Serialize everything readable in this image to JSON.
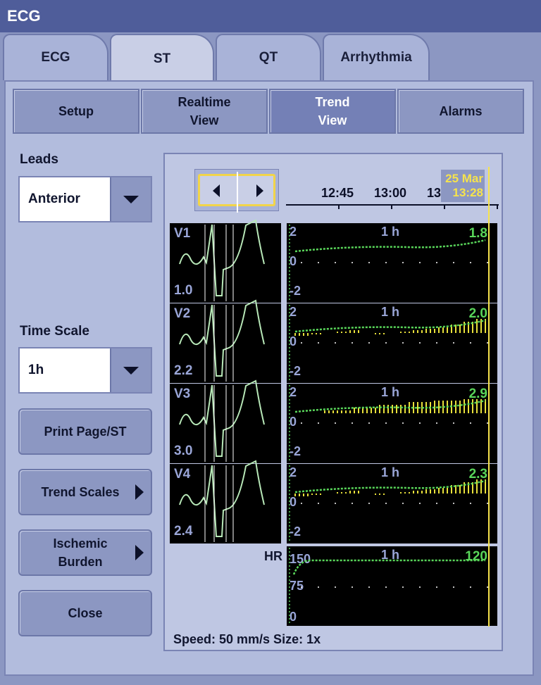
{
  "window": {
    "title": "ECG"
  },
  "tabs": [
    {
      "label": "ECG",
      "active": false
    },
    {
      "label": "ST",
      "active": true
    },
    {
      "label": "QT",
      "active": false
    },
    {
      "label": "Arrhythmia",
      "active": false
    }
  ],
  "subtabs": {
    "setup": "Setup",
    "realtime": [
      "Realtime",
      "View"
    ],
    "trend": [
      "Trend",
      "View"
    ],
    "alarms": "Alarms"
  },
  "left": {
    "leads_label": "Leads",
    "leads_value": "Anterior",
    "timescale_label": "Time Scale",
    "timescale_value": "1h",
    "print_button": "Print Page/ST",
    "trend_scales_button": "Trend Scales",
    "ischemic_button": [
      "Ischemic",
      "Burden"
    ],
    "close_button": "Close"
  },
  "timeline": {
    "ticks": [
      "12:45",
      "13:00",
      "13"
    ],
    "date": "25 Mar",
    "time": "13:28"
  },
  "leads": [
    {
      "name": "V1",
      "value": "1.0",
      "y_top": "2",
      "y_mid": "0",
      "y_bot": "-2",
      "span": "1 h",
      "current": "1.8"
    },
    {
      "name": "V2",
      "value": "2.2",
      "y_top": "2",
      "y_mid": "0",
      "y_bot": "-2",
      "span": "1 h",
      "current": "2.0"
    },
    {
      "name": "V3",
      "value": "3.0",
      "y_top": "2",
      "y_mid": "0",
      "y_bot": "-2",
      "span": "1 h",
      "current": "2.9"
    },
    {
      "name": "V4",
      "value": "2.4",
      "y_top": "2",
      "y_mid": "0",
      "y_bot": "-2",
      "span": "1 h",
      "current": "2.3"
    }
  ],
  "hr": {
    "label": "HR",
    "y_top": "150",
    "y_mid": "75",
    "y_bot": "0",
    "span": "1 h",
    "current": "120"
  },
  "footer": {
    "speed_size": "Speed: 50 mm/s Size: 1x"
  },
  "colors": {
    "trend_line": "#59d65a",
    "trend_bars": "#e8e03a",
    "wave": "#b8e8b8",
    "cursor": "#f6e34c"
  }
}
